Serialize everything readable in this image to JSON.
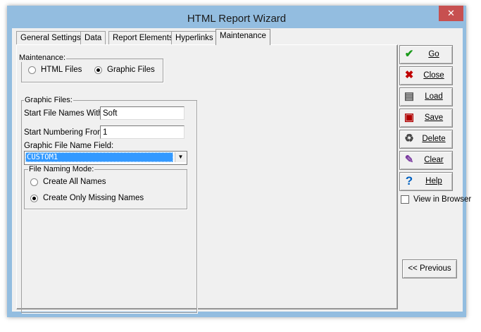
{
  "window": {
    "title": "HTML Report Wizard",
    "close_glyph": "✕"
  },
  "tabs": [
    {
      "label": "General Settings"
    },
    {
      "label": "Data"
    },
    {
      "label": "Report Elements"
    },
    {
      "label": "Hyperlinks"
    },
    {
      "label": "Maintenance"
    }
  ],
  "active_tab": "Maintenance",
  "maintenance": {
    "label": "Maintenance:",
    "options": [
      {
        "label": "HTML Files",
        "selected": false
      },
      {
        "label": "Graphic Files",
        "selected": true
      }
    ]
  },
  "graphic_files": {
    "label": "Graphic Files:",
    "start_names_label": "Start File Names With:",
    "start_names_value": "Soft",
    "start_numbering_label": "Start Numbering From:",
    "start_numbering_value": "1",
    "name_field_label": "Graphic File Name Field:",
    "name_field_value": "CUSTOM1",
    "naming_mode": {
      "label": "File Naming Mode:",
      "options": [
        {
          "label": "Create All Names",
          "selected": false
        },
        {
          "label": "Create Only Missing Names",
          "selected": true
        }
      ]
    }
  },
  "side_buttons": [
    {
      "label": "Go",
      "icon": "checkmark-icon",
      "icon_color": "#1a9a1a"
    },
    {
      "label": "Close",
      "icon": "x-icon",
      "icon_color": "#c00000"
    },
    {
      "label": "Load",
      "icon": "document-icon",
      "icon_color": "#333333"
    },
    {
      "label": "Save",
      "icon": "save-icon",
      "icon_color": "#333333"
    },
    {
      "label": "Delete",
      "icon": "trash-icon",
      "icon_color": "#333333"
    },
    {
      "label": "Clear",
      "icon": "eraser-icon",
      "icon_color": "#333333"
    },
    {
      "label": "Help",
      "icon": "question-icon",
      "icon_color": "#0060c0"
    }
  ],
  "view_in_browser": {
    "label": "View in Browser",
    "checked": false
  },
  "previous_button": {
    "label": "<< Previous"
  },
  "colors": {
    "frame": "#93bde0",
    "selection": "#3399ff",
    "close": "#c75050"
  }
}
